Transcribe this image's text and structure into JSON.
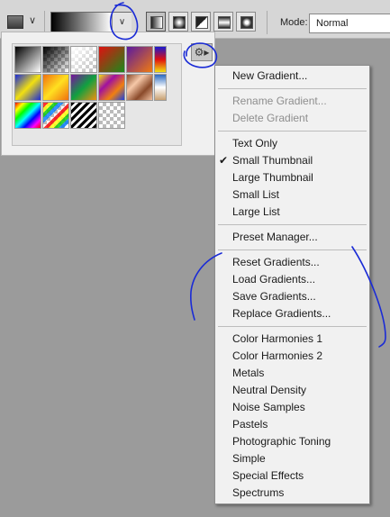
{
  "options_bar": {
    "mode_label": "Mode:",
    "mode_value": "Normal",
    "dropdown_glyph": "∨",
    "gradient_types": [
      "linear",
      "radial",
      "angle",
      "reflected",
      "diamond"
    ],
    "selected_type": "linear"
  },
  "picker_panel": {
    "menu_glyph": "⚙▸",
    "swatches": [
      "black-white",
      "black-transparent",
      "white-transparent",
      "red-green",
      "violet-orange",
      "blue-red-yellow",
      "blue-yellow-blue",
      "orange-yellow-orange",
      "violet-green-orange",
      "yellow-violet-orange-blue",
      "copper",
      "chrome",
      "spectrum",
      "transparent-rainbow",
      "transparent-stripes",
      "checker-transparent"
    ]
  },
  "menu": {
    "check_glyph": "✔",
    "groups": [
      [
        {
          "label": "New Gradient...",
          "enabled": true
        }
      ],
      [
        {
          "label": "Rename Gradient...",
          "enabled": false
        },
        {
          "label": "Delete Gradient",
          "enabled": false
        }
      ],
      [
        {
          "label": "Text Only",
          "enabled": true
        },
        {
          "label": "Small Thumbnail",
          "enabled": true,
          "checked": true
        },
        {
          "label": "Large Thumbnail",
          "enabled": true
        },
        {
          "label": "Small List",
          "enabled": true
        },
        {
          "label": "Large List",
          "enabled": true
        }
      ],
      [
        {
          "label": "Preset Manager...",
          "enabled": true
        }
      ],
      [
        {
          "label": "Reset Gradients...",
          "enabled": true
        },
        {
          "label": "Load Gradients...",
          "enabled": true
        },
        {
          "label": "Save Gradients...",
          "enabled": true
        },
        {
          "label": "Replace Gradients...",
          "enabled": true
        }
      ],
      [
        {
          "label": "Color Harmonies 1",
          "enabled": true
        },
        {
          "label": "Color Harmonies 2",
          "enabled": true
        },
        {
          "label": "Metals",
          "enabled": true
        },
        {
          "label": "Neutral Density",
          "enabled": true
        },
        {
          "label": "Noise Samples",
          "enabled": true
        },
        {
          "label": "Pastels",
          "enabled": true
        },
        {
          "label": "Photographic Toning",
          "enabled": true
        },
        {
          "label": "Simple",
          "enabled": true
        },
        {
          "label": "Special Effects",
          "enabled": true
        },
        {
          "label": "Spectrums",
          "enabled": true
        }
      ]
    ]
  },
  "colors": {
    "annotation_ink": "#1a2bd6",
    "menu_bg": "#f1f1f1",
    "disabled_text": "#8e8e8e"
  }
}
